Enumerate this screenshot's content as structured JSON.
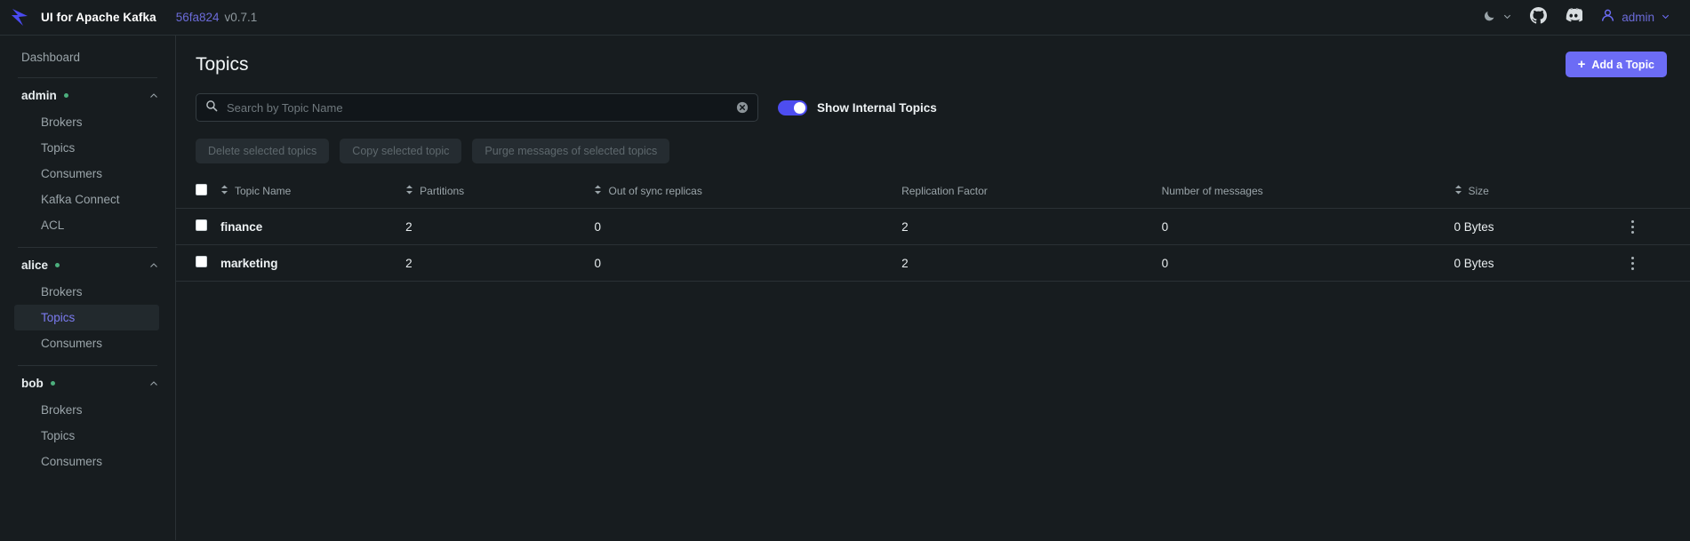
{
  "navbar": {
    "logo_icon": "kafka-logo-icon",
    "brand_title": "UI for Apache Kafka",
    "version_hash": "56fa824",
    "version_number": "v0.7.1",
    "theme_icon": "moon-icon",
    "theme_chevron_icon": "chevron-down-icon",
    "github_icon": "github-icon",
    "discord_icon": "discord-icon",
    "user_icon": "user-icon",
    "user_name": "admin",
    "user_chevron_icon": "chevron-down-icon"
  },
  "sidebar": {
    "dashboard_label": "Dashboard",
    "clusters": [
      {
        "name": "admin",
        "status": "online",
        "chevron_icon": "chevron-up-icon",
        "items": [
          {
            "label": "Brokers",
            "active": false
          },
          {
            "label": "Topics",
            "active": false
          },
          {
            "label": "Consumers",
            "active": false
          },
          {
            "label": "Kafka Connect",
            "active": false
          },
          {
            "label": "ACL",
            "active": false
          }
        ]
      },
      {
        "name": "alice",
        "status": "online",
        "chevron_icon": "chevron-up-icon",
        "items": [
          {
            "label": "Brokers",
            "active": false
          },
          {
            "label": "Topics",
            "active": true
          },
          {
            "label": "Consumers",
            "active": false
          }
        ]
      },
      {
        "name": "bob",
        "status": "online",
        "chevron_icon": "chevron-up-icon",
        "items": [
          {
            "label": "Brokers",
            "active": false
          },
          {
            "label": "Topics",
            "active": false
          },
          {
            "label": "Consumers",
            "active": false
          }
        ]
      }
    ]
  },
  "main": {
    "page_title": "Topics",
    "add_topic_label": "Add a Topic",
    "add_topic_icon": "plus-icon",
    "search": {
      "icon": "search-icon",
      "placeholder": "Search by Topic Name",
      "value": "",
      "clear_icon": "clear-circle-icon"
    },
    "internal_toggle": {
      "label": "Show Internal Topics",
      "enabled": true
    },
    "actions": [
      {
        "label": "Delete selected topics",
        "disabled": true
      },
      {
        "label": "Copy selected topic",
        "disabled": true
      },
      {
        "label": "Purge messages of selected topics",
        "disabled": true
      }
    ],
    "table": {
      "select_all_checked": false,
      "columns": [
        {
          "label": "Topic Name",
          "sortable": true
        },
        {
          "label": "Partitions",
          "sortable": true
        },
        {
          "label": "Out of sync replicas",
          "sortable": true
        },
        {
          "label": "Replication Factor",
          "sortable": false
        },
        {
          "label": "Number of messages",
          "sortable": false
        },
        {
          "label": "Size",
          "sortable": true
        }
      ],
      "rows": [
        {
          "checked": false,
          "name": "finance",
          "partitions": "2",
          "out_of_sync_replicas": "0",
          "replication_factor": "2",
          "number_of_messages": "0",
          "size": "0 Bytes",
          "menu_icon": "kebab-menu-icon"
        },
        {
          "checked": false,
          "name": "marketing",
          "partitions": "2",
          "out_of_sync_replicas": "0",
          "replication_factor": "2",
          "number_of_messages": "0",
          "size": "0 Bytes",
          "menu_icon": "kebab-menu-icon"
        }
      ]
    }
  },
  "colors": {
    "accent": "#6c6cf5",
    "background": "#171c1f",
    "border": "#2a3135",
    "status_online": "#4caf7d",
    "active_link": "#7b7bf0"
  }
}
